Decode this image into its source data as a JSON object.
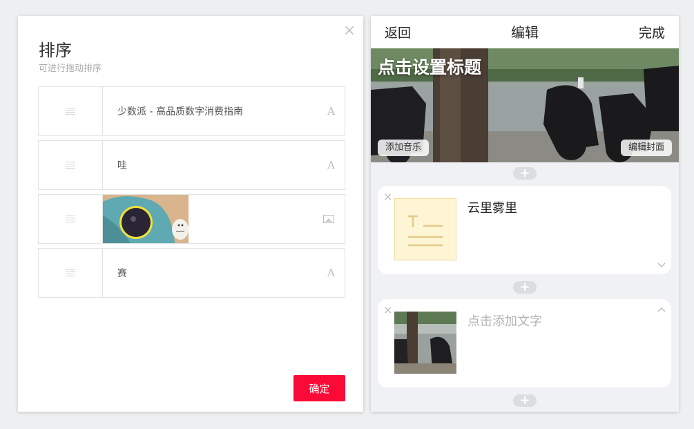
{
  "sort_dialog": {
    "title": "排序",
    "subtitle": "可进行拖动排序",
    "close_symbol": "×",
    "items": [
      {
        "text": "少数派 - 高品质数字消费指南",
        "type_glyph": "A",
        "kind": "text"
      },
      {
        "text": "哇",
        "type_glyph": "A",
        "kind": "text"
      },
      {
        "text": "",
        "type_glyph": "",
        "kind": "image"
      },
      {
        "text": "赛",
        "type_glyph": "A",
        "kind": "text"
      }
    ],
    "confirm_label": "确定",
    "colors": {
      "confirm": "#fa0b37"
    }
  },
  "editor": {
    "back_label": "返回",
    "title": "编辑",
    "done_label": "完成",
    "cover": {
      "title": "点击设置标题",
      "add_music_label": "添加音乐",
      "edit_cover_label": "编辑封面"
    },
    "add_symbol": "+",
    "cards": [
      {
        "text": "云里雾里",
        "placeholder": false,
        "chevron": "down"
      },
      {
        "text": "点击添加文字",
        "placeholder": true,
        "chevron": "up"
      }
    ],
    "delete_symbol": "×"
  }
}
